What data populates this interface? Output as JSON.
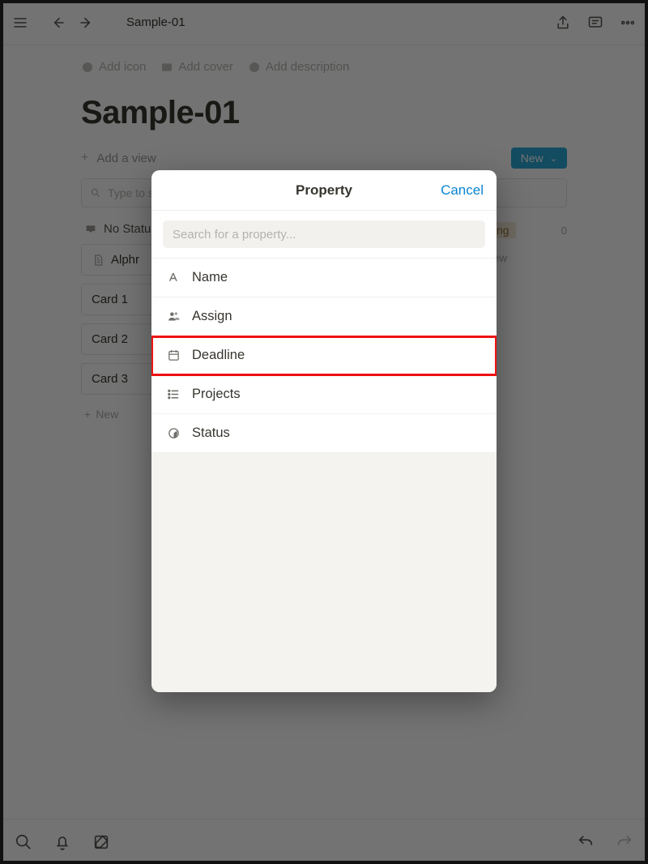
{
  "breadcrumb": "Sample-01",
  "page": {
    "title": "Sample-01",
    "actions": {
      "add_icon": "Add icon",
      "add_cover": "Add cover",
      "add_description": "Add description"
    },
    "add_view": "Add a view",
    "new_button": "New",
    "filter_placeholder": "Type to search...",
    "board": {
      "col1": {
        "header": "No Status",
        "cards": [
          "Alphr",
          "Card 1",
          "Card 2",
          "Card 3"
        ],
        "add": "New"
      },
      "col2": {
        "header": "Doing",
        "count": "0",
        "add": "New"
      }
    }
  },
  "modal": {
    "title": "Property",
    "cancel": "Cancel",
    "search_placeholder": "Search for a property...",
    "properties": [
      {
        "label": "Name",
        "icon": "text-icon"
      },
      {
        "label": "Assign",
        "icon": "person-icon"
      },
      {
        "label": "Deadline",
        "icon": "calendar-icon",
        "highlight": true
      },
      {
        "label": "Projects",
        "icon": "list-icon"
      },
      {
        "label": "Status",
        "icon": "status-icon"
      }
    ]
  }
}
